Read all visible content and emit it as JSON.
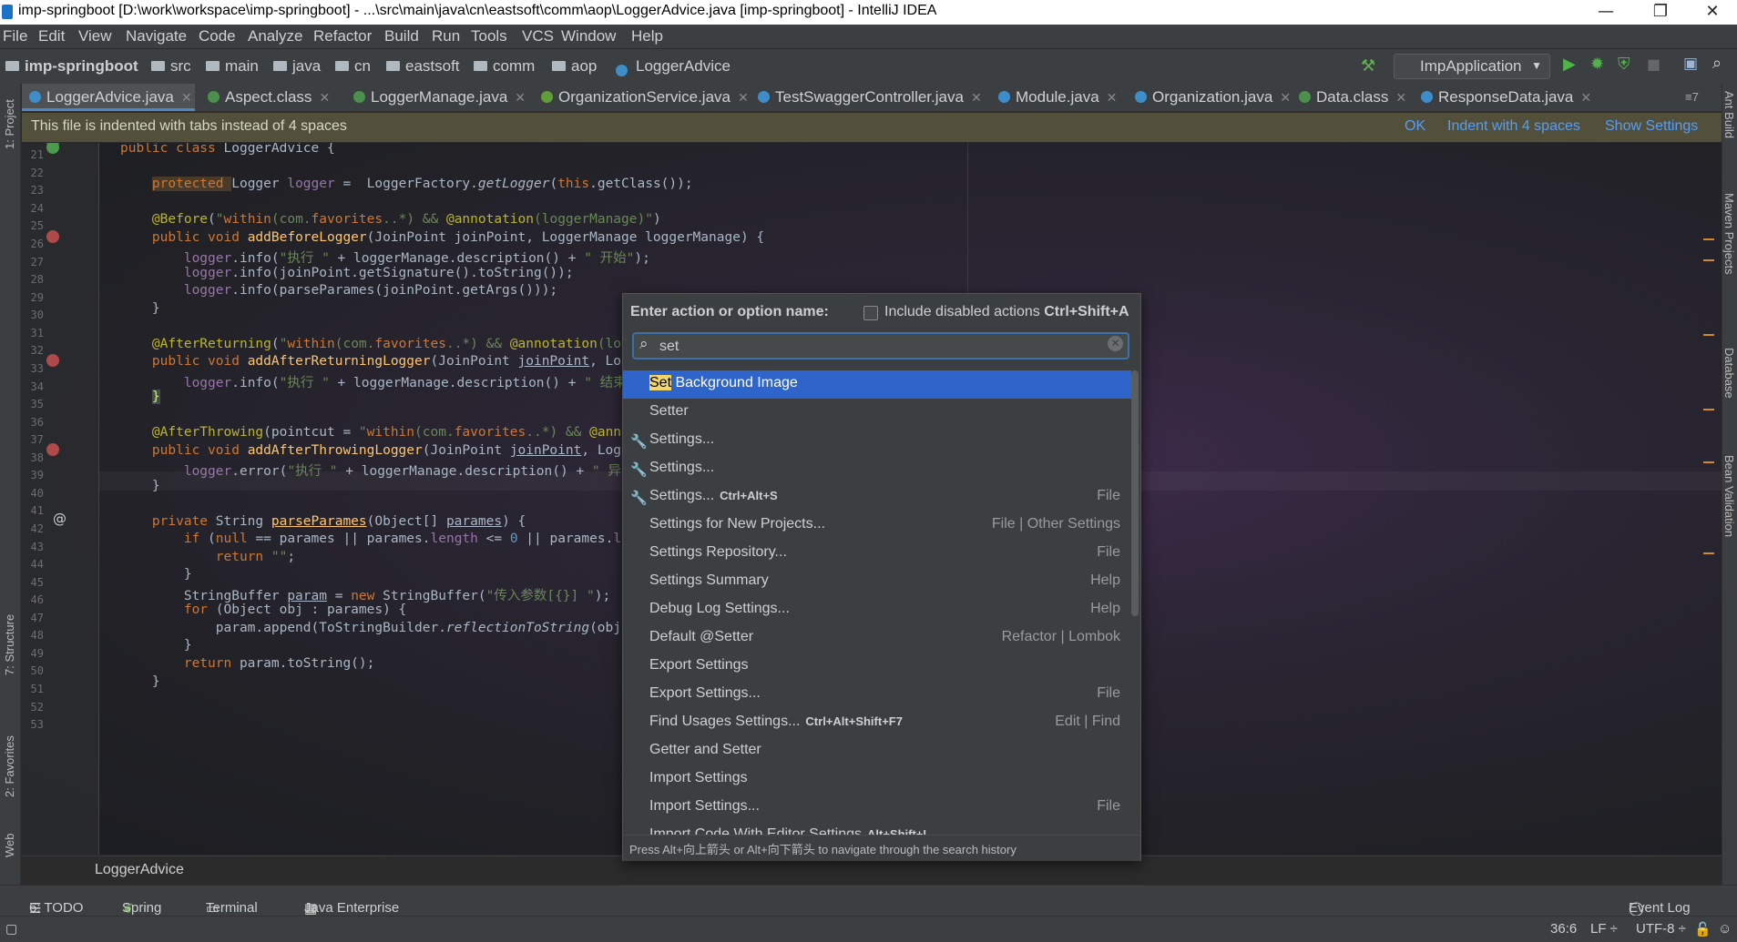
{
  "window": {
    "title": "imp-springboot [D:\\work\\workspace\\imp-springboot] - ...\\src\\main\\java\\cn\\eastsoft\\comm\\aop\\LoggerAdvice.java [imp-springboot] - IntelliJ IDEA",
    "controls": {
      "minimize": "—",
      "maximize": "❐",
      "close": "✕"
    }
  },
  "menu": [
    "File",
    "Edit",
    "View",
    "Navigate",
    "Code",
    "Analyze",
    "Refactor",
    "Build",
    "Run",
    "Tools",
    "VCS",
    "Window",
    "Help"
  ],
  "breadcrumbs": [
    "imp-springboot",
    "src",
    "main",
    "java",
    "cn",
    "eastsoft",
    "comm",
    "aop",
    "LoggerAdvice"
  ],
  "run_config": "ImpApplication",
  "tabs": [
    {
      "label": "LoggerAdvice.java",
      "active": true
    },
    {
      "label": "Aspect.class"
    },
    {
      "label": "LoggerManage.java"
    },
    {
      "label": "OrganizationService.java"
    },
    {
      "label": "TestSwaggerController.java"
    },
    {
      "label": "Module.java"
    },
    {
      "label": "Organization.java"
    },
    {
      "label": "Data.class"
    },
    {
      "label": "ResponseData.java"
    }
  ],
  "tab_overflow": "≡7",
  "notice": {
    "message": "This file is indented with tabs instead of 4 spaces",
    "ok": "OK",
    "indent": "Indent with 4 spaces",
    "show_settings": "Show Settings"
  },
  "line_numbers": [
    "21",
    "22",
    "23",
    "24",
    "25",
    "26",
    "27",
    "28",
    "29",
    "30",
    "31",
    "32",
    "33",
    "34",
    "35",
    "36",
    "37",
    "38",
    "39",
    "40",
    "41",
    "42",
    "43",
    "44",
    "45",
    "46",
    "47",
    "48",
    "49",
    "50",
    "51",
    "52",
    "53"
  ],
  "editor_crumb": "LoggerAdvice",
  "left_tools": [
    "1: Project",
    "7: Structure",
    "2: Favorites",
    "Web"
  ],
  "right_tools": [
    "Ant Build",
    "Maven Projects",
    "Database",
    "Bean Validation"
  ],
  "bottom_tools": [
    "6: TODO",
    "Spring",
    "Terminal",
    "Java Enterprise"
  ],
  "event_log": "Event Log",
  "status": {
    "position": "36:6",
    "line_sep": "LF ÷",
    "encoding": "UTF-8 ÷"
  },
  "popup": {
    "header": "Enter action or option name:",
    "include_disabled": "Include disabled actions",
    "include_shortcut": "Ctrl+Shift+A",
    "search_value": "set",
    "footer": "Press Alt+向上箭头 or Alt+向下箭头 to navigate through the search history",
    "items": [
      {
        "pre": "",
        "hl": "Set",
        "post": " Background Image",
        "shortcut": "",
        "group": "",
        "wrench": false,
        "selected": true
      },
      {
        "pre": "Setter",
        "hl": "",
        "post": "",
        "shortcut": "",
        "group": "",
        "wrench": false
      },
      {
        "pre": "Settings...",
        "hl": "",
        "post": "",
        "shortcut": "",
        "group": "",
        "wrench": true
      },
      {
        "pre": "Settings...",
        "hl": "",
        "post": "",
        "shortcut": "",
        "group": "",
        "wrench": true
      },
      {
        "pre": "Settings...",
        "hl": "",
        "post": "",
        "shortcut": "Ctrl+Alt+S",
        "group": "File",
        "wrench": true
      },
      {
        "pre": "Settings for New Projects...",
        "hl": "",
        "post": "",
        "shortcut": "",
        "group": "File | Other Settings",
        "wrench": false
      },
      {
        "pre": "Settings Repository...",
        "hl": "",
        "post": "",
        "shortcut": "",
        "group": "File",
        "wrench": false
      },
      {
        "pre": "Settings Summary",
        "hl": "",
        "post": "",
        "shortcut": "",
        "group": "Help",
        "wrench": false
      },
      {
        "pre": "Debug Log Settings...",
        "hl": "",
        "post": "",
        "shortcut": "",
        "group": "Help",
        "wrench": false
      },
      {
        "pre": "Default @Setter",
        "hl": "",
        "post": "",
        "shortcut": "",
        "group": "Refactor | Lombok",
        "wrench": false
      },
      {
        "pre": "Export Settings",
        "hl": "",
        "post": "",
        "shortcut": "",
        "group": "",
        "wrench": false
      },
      {
        "pre": "Export Settings...",
        "hl": "",
        "post": "",
        "shortcut": "",
        "group": "File",
        "wrench": false
      },
      {
        "pre": "Find Usages Settings...",
        "hl": "",
        "post": "",
        "shortcut": "Ctrl+Alt+Shift+F7",
        "group": "Edit | Find",
        "wrench": false
      },
      {
        "pre": "Getter and Setter",
        "hl": "",
        "post": "",
        "shortcut": "",
        "group": "",
        "wrench": false
      },
      {
        "pre": "Import Settings",
        "hl": "",
        "post": "",
        "shortcut": "",
        "group": "",
        "wrench": false
      },
      {
        "pre": "Import Settings...",
        "hl": "",
        "post": "",
        "shortcut": "",
        "group": "File",
        "wrench": false
      },
      {
        "pre": "Import Code With Editor Settings",
        "hl": "",
        "post": "",
        "shortcut": "Alt+Shift+I",
        "group": "",
        "wrench": false
      }
    ]
  },
  "colors": {
    "accent": "#2f65ca",
    "notice_bg": "#52503a",
    "link": "#589df6"
  }
}
